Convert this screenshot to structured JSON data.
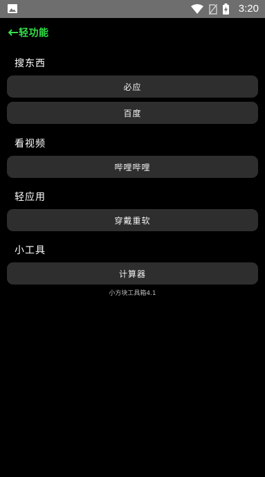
{
  "status_bar": {
    "time": "3:20",
    "icons": [
      "gallery-icon",
      "wifi-icon",
      "no-sim-icon",
      "battery-charging-icon"
    ]
  },
  "nav": {
    "back_label": "轻功能",
    "accent_color": "#34e04a"
  },
  "sections": [
    {
      "title": "搜东西",
      "buttons": [
        "必应",
        "百度"
      ]
    },
    {
      "title": "看视频",
      "buttons": [
        "哔哩哔哩"
      ]
    },
    {
      "title": "轻应用",
      "buttons": [
        "穿戴重软"
      ]
    },
    {
      "title": "小工具",
      "buttons": [
        "计算器"
      ]
    }
  ],
  "footer": "小方块工具箱4.1",
  "colors": {
    "background": "#000000",
    "button": "#2e2e2e",
    "status_bar": "#6e6e6e"
  }
}
